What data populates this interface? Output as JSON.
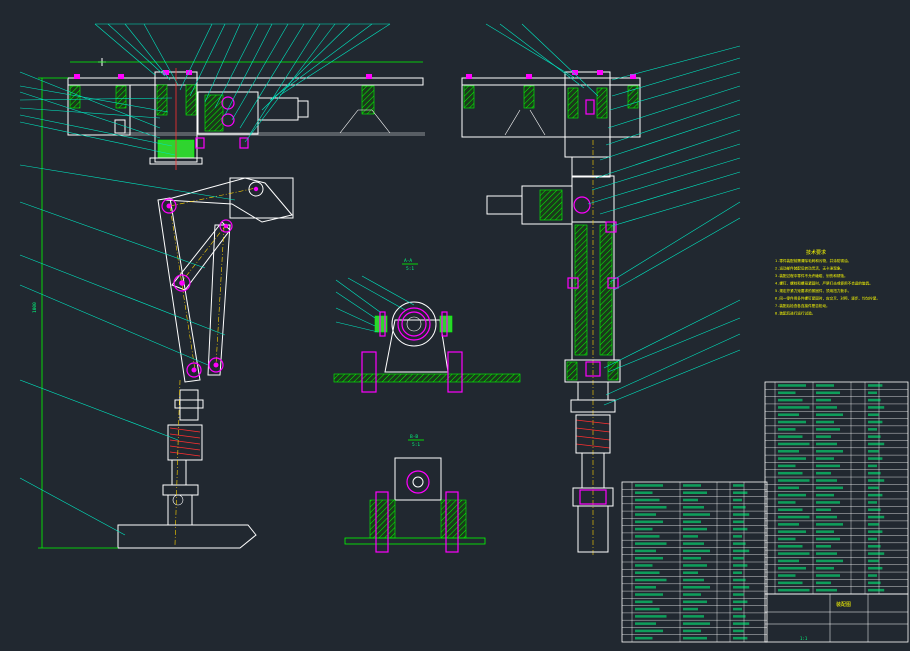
{
  "section_a": {
    "title": "A-A",
    "scale": "5:1"
  },
  "section_b": {
    "title": "B-B",
    "scale": "5:1"
  },
  "tech_requirements": {
    "title": "技术要求",
    "lines": [
      "1.零件装配前需清除毛刺和污物，并涂防锈油。",
      "2.运动部件装配后转动灵活，无卡滞现象。",
      "3.装配过程中零件不允许磕碰、划伤和锈蚀。",
      "4.螺钉、螺栓和螺母紧固时，严禁打击或使用不合适的旋具。",
      "5.规定拧紧力矩要求的紧固件，须用扭力扳手。",
      "6.同一零件用多件螺钉紧固时，应交叉、对称、逐步、均匀拧紧。",
      "7.装配后检查各连接件是否松动。",
      "8.装配后进行运行试验。"
    ]
  },
  "dimension_left": "1000",
  "title_block": {
    "drawing_name": "装配图",
    "scale": "1:1"
  }
}
